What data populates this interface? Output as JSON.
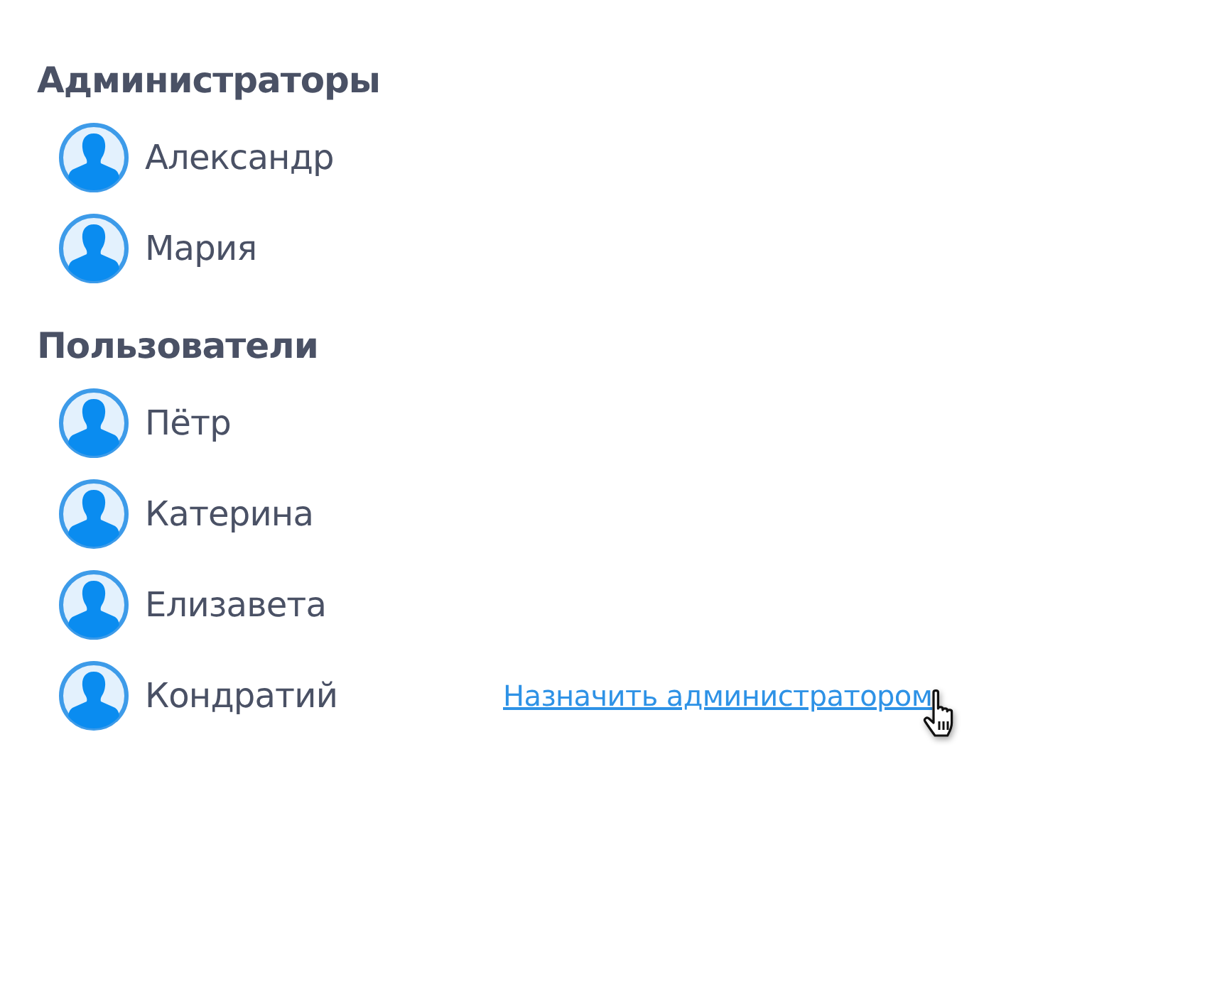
{
  "sections": [
    {
      "heading": "Администраторы",
      "users": [
        {
          "name": "Александр"
        },
        {
          "name": "Мария"
        }
      ]
    },
    {
      "heading": "Пользователи",
      "users": [
        {
          "name": "Пётр"
        },
        {
          "name": "Катерина"
        },
        {
          "name": "Елизавета"
        },
        {
          "name": "Кондратий",
          "action": {
            "label": "Назначить администратором",
            "hovered": true
          }
        }
      ]
    }
  ]
}
